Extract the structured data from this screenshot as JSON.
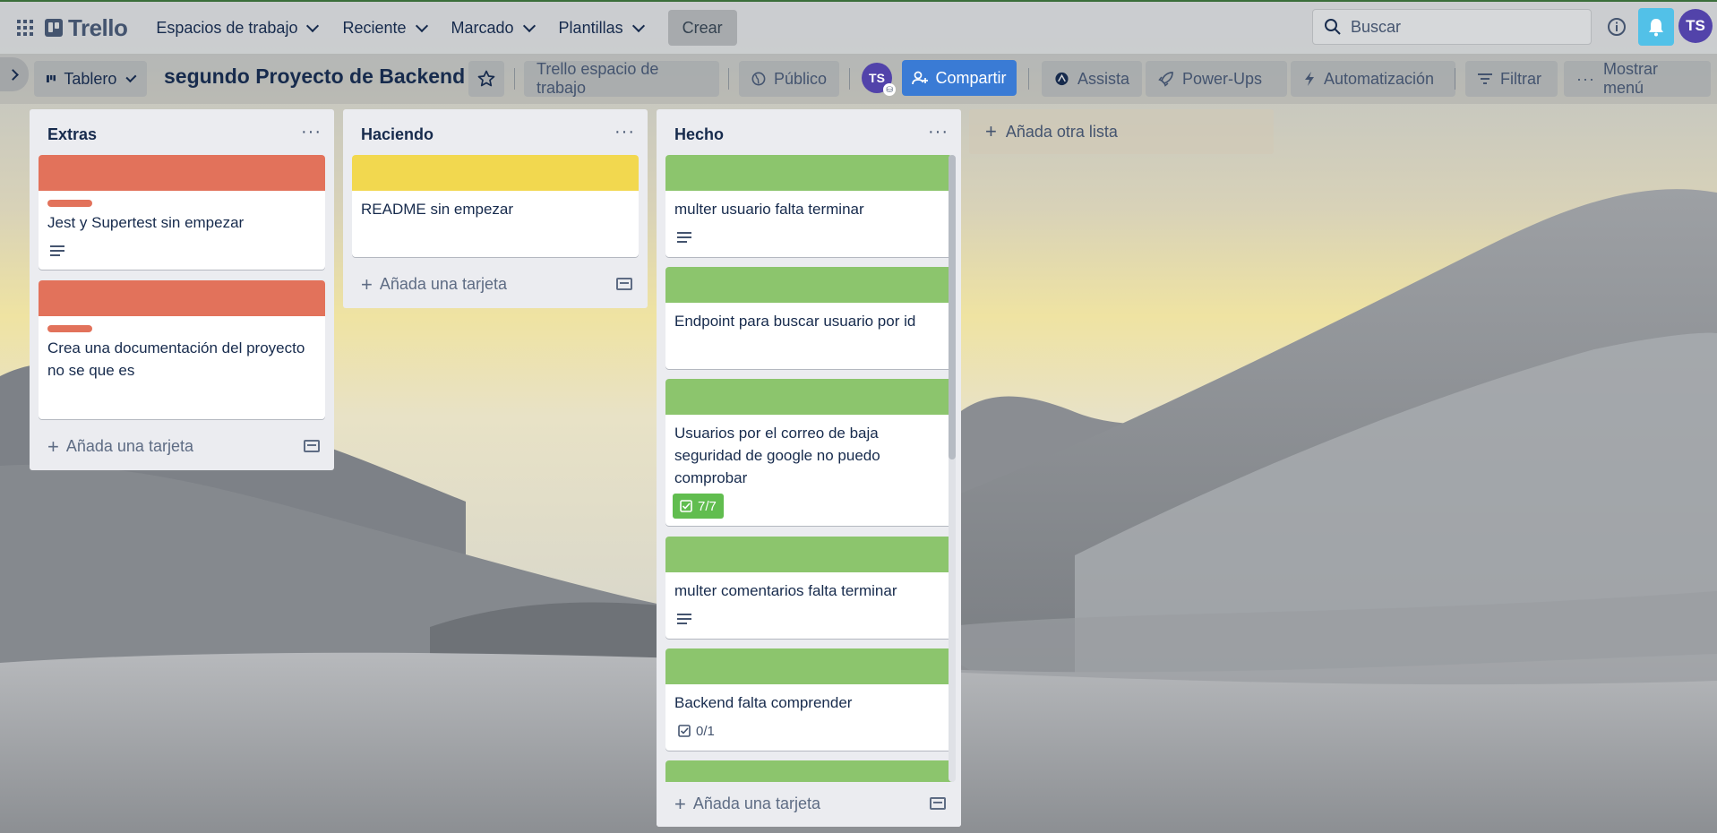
{
  "topnav": {
    "app_name": "Trello",
    "menus": [
      {
        "label": "Espacios de trabajo"
      },
      {
        "label": "Reciente"
      },
      {
        "label": "Marcado"
      },
      {
        "label": "Plantillas"
      }
    ],
    "create_label": "Crear",
    "search_placeholder": "Buscar",
    "user_initials": "TS"
  },
  "board": {
    "view_label": "Tablero",
    "title": "segundo Proyecto de Backend",
    "workspace_label": "Trello espacio de trabajo",
    "visibility_label": "Público",
    "member_initials": "TS",
    "share_label": "Compartir",
    "assist_label": "Assista",
    "powerups_label": "Power-Ups",
    "automation_label": "Automatización",
    "filter_label": "Filtrar",
    "menu_label": "Mostrar menú"
  },
  "colors": {
    "red_label": "#e2725b",
    "yellow_label": "#f2d84f",
    "green_label": "#8cc56d",
    "share_button": "#3a7bd5",
    "avatar": "#5243aa"
  },
  "lists": [
    {
      "title": "Extras",
      "add_card": "Añada una tarjeta",
      "cards": [
        {
          "text": "Jest y Supertest sin empezar",
          "cover": "red",
          "has_label": true,
          "has_description": true
        },
        {
          "text": "Crea una documentación del proyecto no se que es",
          "cover": "red",
          "has_label": true,
          "has_description": false
        }
      ]
    },
    {
      "title": "Haciendo",
      "add_card": "Añada una tarjeta",
      "cards": [
        {
          "text": "README sin empezar",
          "cover": "yellow"
        }
      ]
    },
    {
      "title": "Hecho",
      "add_card": "Añada una tarjeta",
      "cards": [
        {
          "text": "multer usuario falta terminar",
          "cover": "green",
          "has_description": true
        },
        {
          "text": "Endpoint para buscar usuario por id",
          "cover": "green"
        },
        {
          "text": "Usuarios por el correo de baja seguridad de google no puedo comprobar",
          "cover": "green",
          "checklist": "7/7",
          "checklist_complete": true
        },
        {
          "text": "multer comentarios falta terminar",
          "cover": "green",
          "has_description": true
        },
        {
          "text": "Backend falta comprender",
          "cover": "green",
          "checklist": "0/1",
          "checklist_complete": false
        },
        {
          "text": "",
          "cover": "green"
        }
      ]
    }
  ],
  "add_list_label": "Añada otra lista"
}
